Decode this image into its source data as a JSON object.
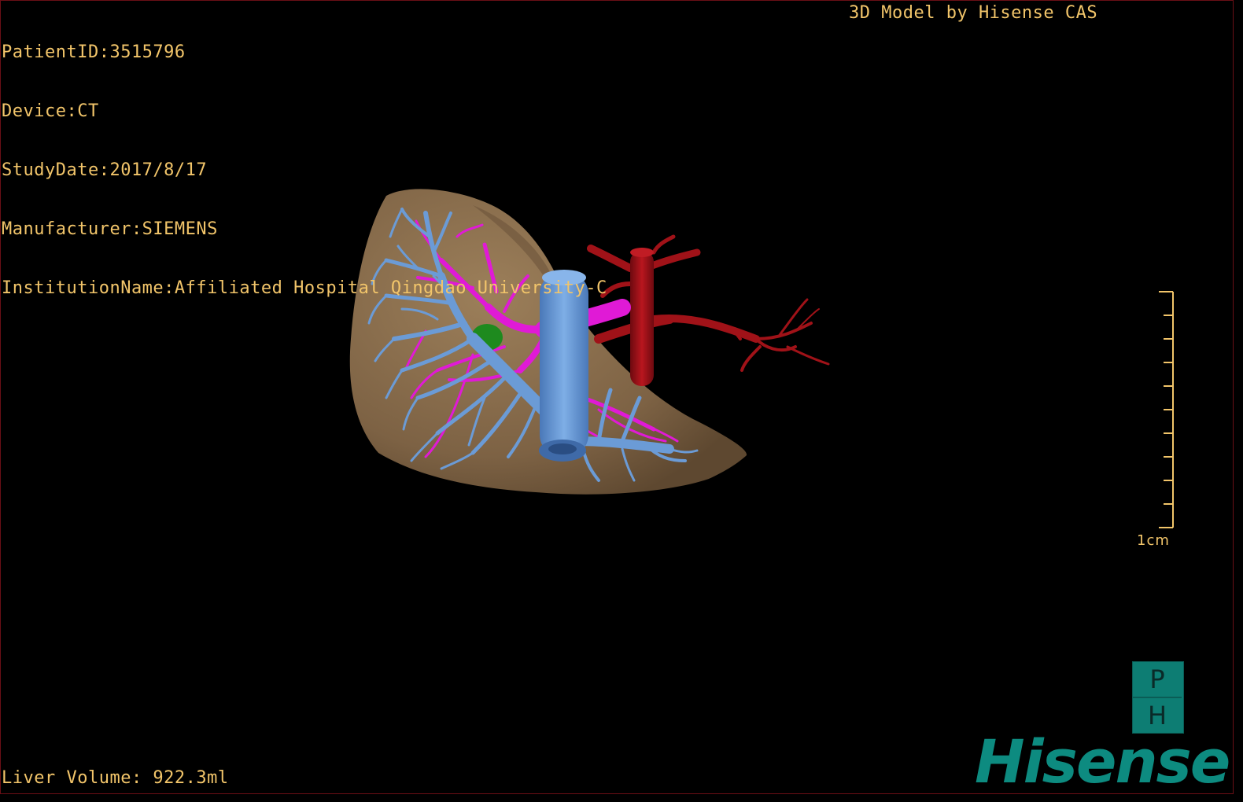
{
  "header": {
    "patient_id": "PatientID:3515796",
    "device": "Device:CT",
    "study_date": "StudyDate:2017/8/17",
    "manufacturer": "Manufacturer:SIEMENS",
    "institution": "InstitutionName:Affiliated Hospital Qingdao University-C",
    "model_credit": "3D Model by Hisense CAS"
  },
  "footer": {
    "liver_volume": "Liver Volume: 922.3ml"
  },
  "scale": {
    "label": "1cm",
    "tick_count": 11
  },
  "logos": {
    "ph_top": "P",
    "ph_bottom": "H",
    "brand": "Hisense"
  },
  "colors": {
    "overlay_text": "#f2c56a",
    "liver": "#8a6e4c",
    "portal_vein": "#6b9bd6",
    "hepatic_vein": "#e01ad6",
    "artery": "#a01218",
    "gallbladder": "#1e8a1e",
    "brand": "#0d8b80"
  },
  "model": {
    "structures": [
      "liver",
      "portal-vein",
      "hepatic-vein",
      "hepatic-artery",
      "gallbladder"
    ]
  }
}
